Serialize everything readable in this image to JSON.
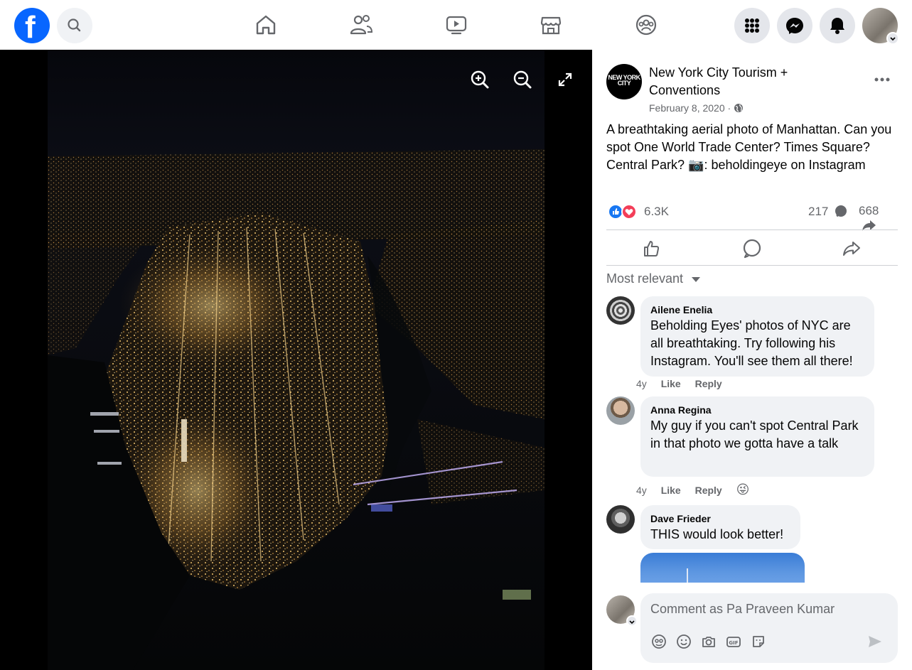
{
  "topbar": {
    "logo_letter": "f",
    "nav": [
      "home",
      "friends",
      "watch",
      "marketplace",
      "groups"
    ],
    "right_buttons": [
      "menu-grid",
      "messenger",
      "notifications",
      "account"
    ]
  },
  "post": {
    "page_name": "New York City Tourism + Conventions",
    "avatar_text": "NEW YORK CITY",
    "date": "February 8, 2020 ·",
    "text": "A breathtaking aerial photo of Manhattan. Can you spot One World Trade Center? Times Square? Central Park? 📷: beholdingeye on Instagram",
    "reactions_count": "6.3K",
    "comments_count": "217",
    "shares_count": "668"
  },
  "sort_label": "Most relevant",
  "comments": [
    {
      "author": "Ailene Enelia",
      "text": "Beholding Eyes' photos of NYC are all breathtaking. Try following his Instagram. You'll see them all there!",
      "age": "4y",
      "like": "Like",
      "reply": "Reply"
    },
    {
      "author": "Anna Regina",
      "text": "My guy if you can't spot Central Park in that photo we gotta have a talk",
      "age": "4y",
      "like": "Like",
      "reply": "Reply",
      "reaction": "😜"
    },
    {
      "author": "Dave Frieder",
      "text": "THIS would look better!"
    }
  ],
  "composer": {
    "placeholder": "Comment as Pa Praveen Kumar"
  },
  "colors": {
    "brand": "#0866ff",
    "like": "#1877f2",
    "love": "#f33e58",
    "secondary_text": "#65676b",
    "bubble": "#f0f2f5"
  }
}
